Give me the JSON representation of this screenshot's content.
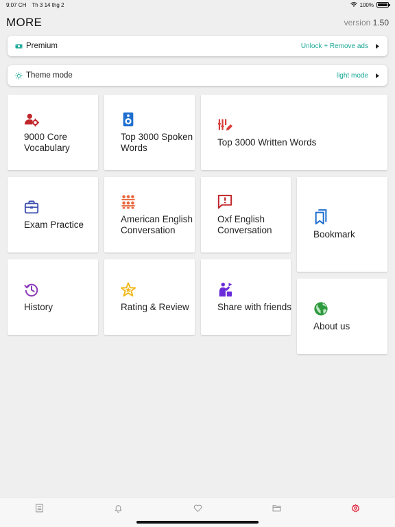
{
  "status_bar": {
    "time": "9:07 CH",
    "date": "Th 3 14 thg 2",
    "battery": "100%"
  },
  "header": {
    "title": "MORE",
    "version_label": "version",
    "version_number": "1.50"
  },
  "premium": {
    "label": "Premium",
    "value": "Unlock + Remove ads",
    "icon": "money-icon"
  },
  "theme": {
    "label": "Theme mode",
    "value": "light mode",
    "icon": "sun-icon"
  },
  "tiles": {
    "core_vocab": {
      "label": "9000 Core Vocabulary",
      "icon": "user-gear-icon",
      "color": "#c0282c"
    },
    "spoken": {
      "label": "Top 3000 Spoken Words",
      "icon": "speaker-icon",
      "color": "#1e6fd0"
    },
    "written": {
      "label": "Top 3000 Written Words",
      "icon": "pencil-bars-icon",
      "color": "#d83a3a"
    },
    "exam": {
      "label": "Exam Practice",
      "icon": "briefcase-icon",
      "color": "#3a4db0"
    },
    "american": {
      "label": "American English Conversation",
      "icon": "group-icon",
      "color": "#e8663a"
    },
    "oxf": {
      "label": "Oxf English Conversation",
      "icon": "chat-icon",
      "color": "#c0282c"
    },
    "bookmark": {
      "label": "Bookmark",
      "icon": "bookmark-icon",
      "color": "#1e6fd0"
    },
    "history": {
      "label": "History",
      "icon": "history-icon",
      "color": "#8e3ab8"
    },
    "rating": {
      "label": "Rating & Review",
      "icon": "star-icon",
      "color": "#f2b81d"
    },
    "share": {
      "label": "Share with friends",
      "icon": "share-icon",
      "color": "#6a2bd8"
    },
    "about": {
      "label": "About us",
      "icon": "globe-icon",
      "color": "#2e9a3e"
    }
  },
  "tabbar": {
    "items": [
      {
        "icon": "list-icon",
        "active": false
      },
      {
        "icon": "bell-icon",
        "active": false
      },
      {
        "icon": "heart-icon",
        "active": false
      },
      {
        "icon": "folder-icon",
        "active": false
      },
      {
        "icon": "gear-icon",
        "active": true
      }
    ],
    "active_color": "#e0223a",
    "inactive_color": "#9a9a9a"
  }
}
